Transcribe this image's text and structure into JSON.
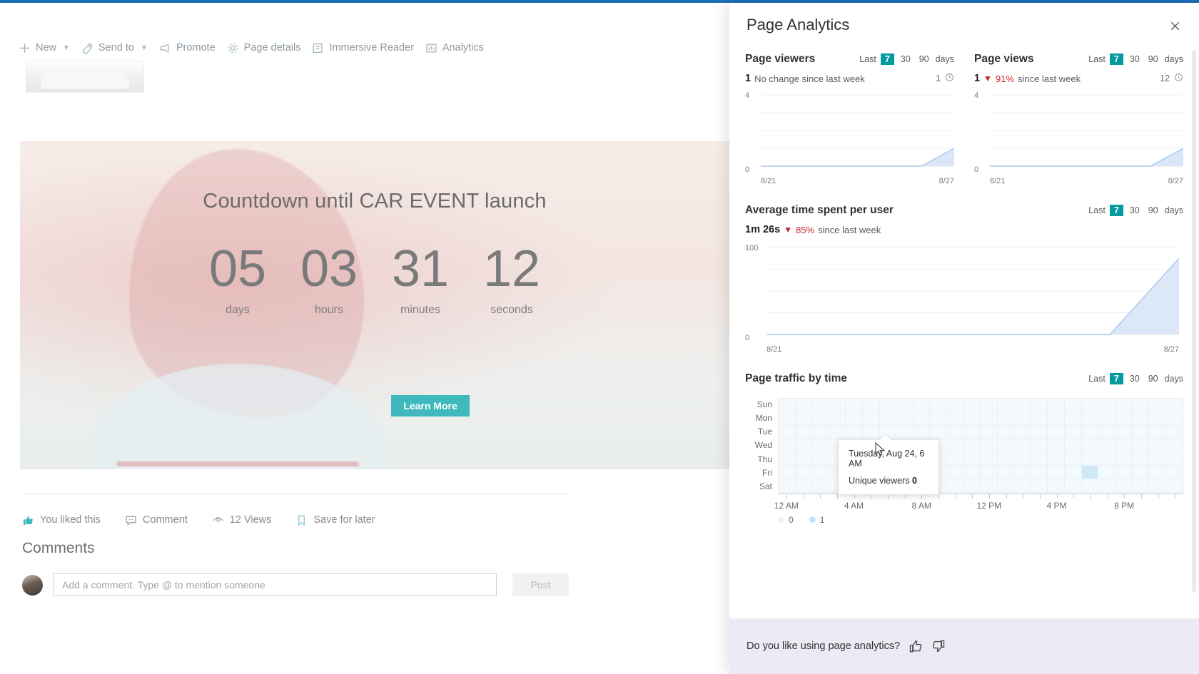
{
  "window": {
    "accent_color": "#1e6fb8"
  },
  "commandbar": {
    "items": [
      {
        "label": "New",
        "icon": "plus-icon",
        "has_chevron": true
      },
      {
        "label": "Send to",
        "icon": "send-icon",
        "has_chevron": true
      },
      {
        "label": "Promote",
        "icon": "megaphone-icon",
        "has_chevron": false
      },
      {
        "label": "Page details",
        "icon": "gear-icon",
        "has_chevron": false
      },
      {
        "label": "Immersive Reader",
        "icon": "reader-icon",
        "has_chevron": false
      },
      {
        "label": "Analytics",
        "icon": "analytics-icon",
        "has_chevron": false
      }
    ]
  },
  "hero": {
    "title": "Countdown until CAR EVENT launch",
    "units": [
      {
        "value": "05",
        "label": "days"
      },
      {
        "value": "03",
        "label": "hours"
      },
      {
        "value": "31",
        "label": "minutes"
      },
      {
        "value": "12",
        "label": "seconds"
      }
    ],
    "cta_label": "Learn More",
    "cta_color": "#3fb9bd"
  },
  "social": {
    "like_label": "You liked this",
    "comment_label": "Comment",
    "views_label": "12 Views",
    "save_label": "Save for later",
    "liked_color": "#3fb9bd"
  },
  "comments": {
    "heading": "Comments",
    "placeholder": "Add a comment. Type @ to mention someone",
    "value": "",
    "post_label": "Post"
  },
  "panel": {
    "title": "Page Analytics",
    "close_icon": "close-icon",
    "selected_chip_color": "#039ba1",
    "decline_color": "#c6242b",
    "footer": {
      "question": "Do you like using page analytics?",
      "thumbs_up_icon": "thumbs-up-icon",
      "thumbs_down_icon": "thumbs-down-icon"
    },
    "range_control": {
      "prefix": "Last",
      "options": [
        "7",
        "30",
        "90"
      ],
      "selected": "7",
      "suffix": "days"
    },
    "metrics": [
      {
        "id": "page-viewers",
        "title": "Page viewers",
        "value": "1",
        "change_text": "No change since last week",
        "has_decline": false,
        "decline_pct": "",
        "side_value": "1",
        "side_icon": "clock-icon"
      },
      {
        "id": "page-views",
        "title": "Page views",
        "value": "1",
        "change_text": "since last week",
        "has_decline": true,
        "decline_pct": "91%",
        "side_value": "12",
        "side_icon": "clock-icon"
      }
    ],
    "avg_time": {
      "title": "Average time spent per user",
      "value": "1m 26s",
      "decline_pct": "85%",
      "change_text": "since last week"
    },
    "traffic": {
      "title": "Page traffic by time",
      "tooltip": {
        "line1": "Tuesday, Aug 24, 6 AM",
        "label": "Unique viewers",
        "value": "0"
      },
      "legend": [
        {
          "swatch": "sw0",
          "label": "0"
        },
        {
          "swatch": "sw1",
          "label": "1"
        }
      ]
    }
  },
  "chart_data": [
    {
      "type": "area",
      "id": "page-viewers-trend",
      "title": "Page viewers",
      "x": [
        "8/21",
        "8/22",
        "8/23",
        "8/24",
        "8/25",
        "8/26",
        "8/27"
      ],
      "values": [
        0,
        0,
        0,
        0,
        0,
        0,
        1
      ],
      "ylim": [
        0,
        4
      ],
      "yticks": [
        "0",
        "4"
      ],
      "xlabel": "",
      "ylabel": "",
      "grid": true,
      "legend": "none",
      "line_color": "#a9c6ea",
      "fill_color": "#dbe7f7"
    },
    {
      "type": "area",
      "id": "page-views-trend",
      "title": "Page views",
      "x": [
        "8/21",
        "8/22",
        "8/23",
        "8/24",
        "8/25",
        "8/26",
        "8/27"
      ],
      "values": [
        0,
        0,
        0,
        0,
        0,
        0,
        1
      ],
      "ylim": [
        0,
        4
      ],
      "yticks": [
        "0",
        "4"
      ],
      "xlabel": "",
      "ylabel": "",
      "grid": true,
      "legend": "none",
      "line_color": "#a9c6ea",
      "fill_color": "#dbe7f7"
    },
    {
      "type": "area",
      "id": "avg-time-trend",
      "title": "Average time spent per user",
      "x": [
        "8/21",
        "8/22",
        "8/23",
        "8/24",
        "8/25",
        "8/26",
        "8/27"
      ],
      "values": [
        0,
        0,
        0,
        0,
        0,
        0,
        86
      ],
      "ylim": [
        0,
        100
      ],
      "yticks": [
        "0",
        "100"
      ],
      "xlabel": "",
      "ylabel": "",
      "grid": true,
      "legend": "none",
      "line_color": "#a9c6ea",
      "fill_color": "#dbe7f7"
    },
    {
      "type": "heatmap",
      "id": "page-traffic-by-time",
      "title": "Page traffic by time",
      "rows": [
        "Sun",
        "Mon",
        "Tue",
        "Wed",
        "Thu",
        "Fri",
        "Sat"
      ],
      "xticks": [
        "12 AM",
        "4 AM",
        "8 AM",
        "12 PM",
        "4 PM",
        "8 PM"
      ],
      "xtick_hours": [
        0,
        4,
        8,
        12,
        16,
        20
      ],
      "hours": 24,
      "zlim": [
        0,
        1
      ],
      "cells": [
        {
          "day": "Fri",
          "hour": 18,
          "value": 1
        }
      ],
      "legend_values": [
        "0",
        "1"
      ]
    }
  ]
}
